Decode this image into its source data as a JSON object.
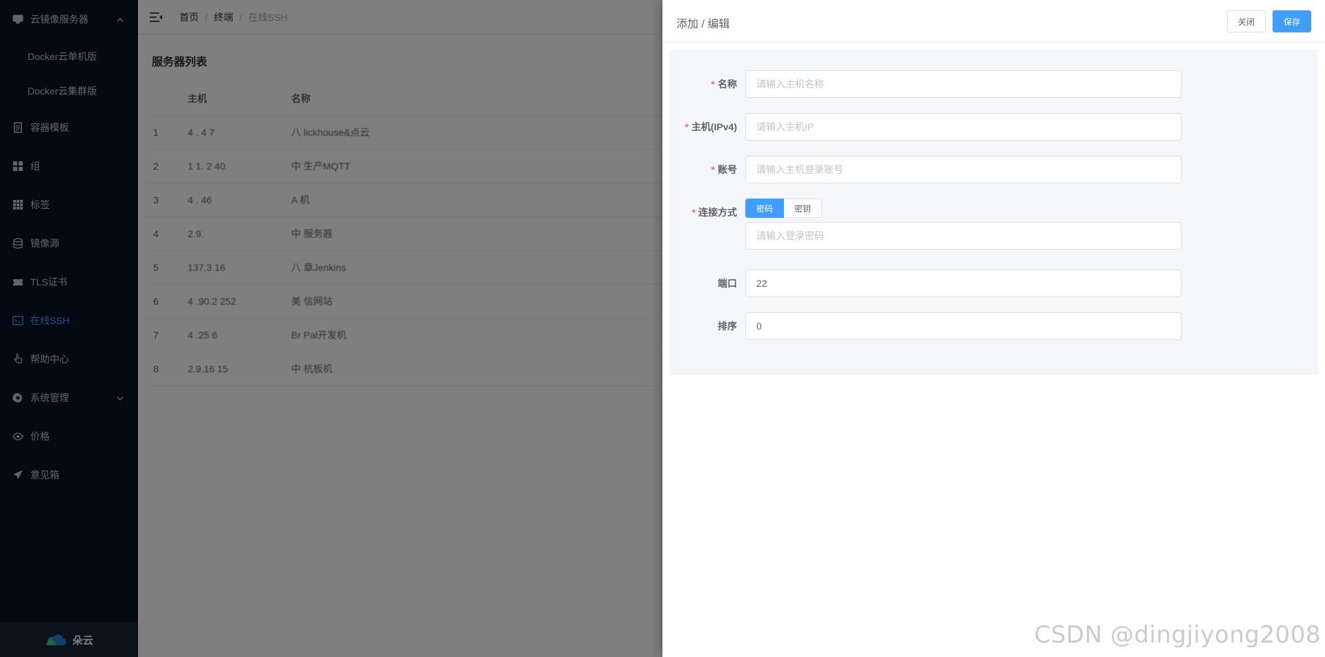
{
  "sidebar": {
    "items": [
      {
        "label": "云镜像服务器",
        "icon": "monitor-icon"
      },
      {
        "label": "Docker云单机版"
      },
      {
        "label": "Docker云集群版"
      },
      {
        "label": "容器模板",
        "icon": "document-icon"
      },
      {
        "label": "组",
        "icon": "grid-icon"
      },
      {
        "label": "标签",
        "icon": "apps-icon"
      },
      {
        "label": "镜像源",
        "icon": "database-icon"
      },
      {
        "label": "TLS证书",
        "icon": "ticket-icon"
      },
      {
        "label": "在线SSH",
        "icon": "terminal-icon",
        "active": true
      },
      {
        "label": "帮助中心",
        "icon": "hand-pointer-icon"
      },
      {
        "label": "系统管理",
        "icon": "gear-icon"
      },
      {
        "label": "价格",
        "icon": "eye-icon"
      },
      {
        "label": "意见箱",
        "icon": "send-icon"
      }
    ],
    "footer_label": "朵云"
  },
  "breadcrumb": [
    "首页",
    "终端",
    "在线SSH"
  ],
  "breadcrumb_sep": "/",
  "list": {
    "title": "服务器列表",
    "columns": [
      "",
      "主机",
      "名称"
    ],
    "rows": [
      {
        "idx": "1",
        "host": "4 .   4  7",
        "name": "八       lickhouse&点云"
      },
      {
        "idx": "2",
        "host": "1 1.      2  40",
        "name": "中   生产MQTT"
      },
      {
        "idx": "3",
        "host": "4 .      46",
        "name": "A      机"
      },
      {
        "idx": "4",
        "host": "   2.9.",
        "name": "中        服务器"
      },
      {
        "idx": "5",
        "host": "  137.3    16",
        "name": "八     章Jenkins"
      },
      {
        "idx": "6",
        "host": "4  .90.2    252",
        "name": "美     信网站"
      },
      {
        "idx": "7",
        "host": "4  .25      6",
        "name": "Br     Pal开发机"
      },
      {
        "idx": "8",
        "host": "   2.9.16    15",
        "name": "中      杭板机"
      }
    ]
  },
  "drawer": {
    "title": "添加 / 编辑",
    "close_label": "关闭",
    "save_label": "保存",
    "fields": {
      "name": {
        "label": "名称",
        "placeholder": "请输入主机名称",
        "value": ""
      },
      "host": {
        "label": "主机(IPv4)",
        "placeholder": "请输入主机IP",
        "value": ""
      },
      "account": {
        "label": "账号",
        "placeholder": "请输入主机登录账号",
        "value": ""
      },
      "connect": {
        "label": "连接方式",
        "options": [
          "密码",
          "密钥"
        ],
        "selected": "密码",
        "placeholder": "请输入登录密码",
        "value": ""
      },
      "port": {
        "label": "端口",
        "placeholder": "",
        "value": "22"
      },
      "sort": {
        "label": "排序",
        "placeholder": "",
        "value": "0"
      }
    }
  },
  "watermark": "CSDN @dingjiyong2008",
  "colors": {
    "sidebar_bg": "#0b1525",
    "accent": "#409eff",
    "required": "#f56c6c"
  }
}
